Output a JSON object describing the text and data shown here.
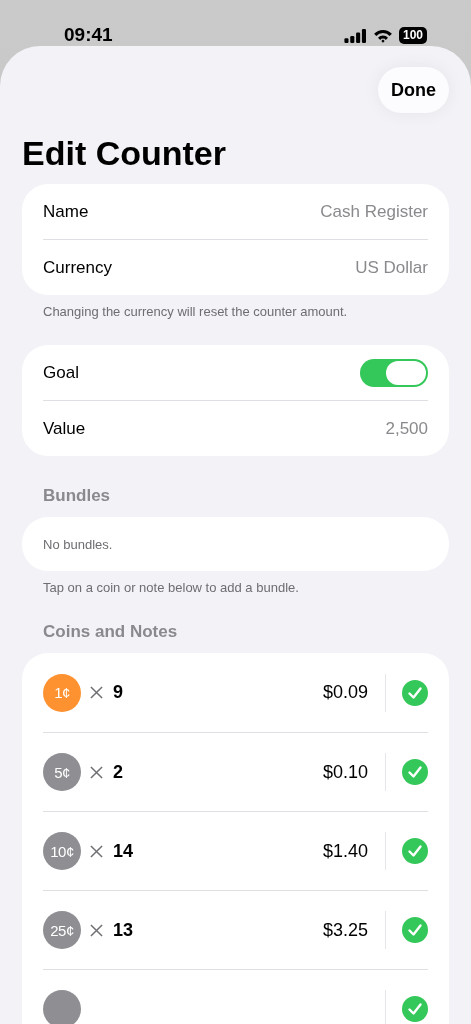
{
  "status_bar": {
    "time": "09:41",
    "battery": "100"
  },
  "done_button": "Done",
  "title": "Edit Counter",
  "details": {
    "rows": [
      {
        "label": "Name",
        "value": "Cash Register"
      },
      {
        "label": "Currency",
        "value": "US Dollar"
      }
    ],
    "footer": "Changing the currency will reset the counter amount."
  },
  "goal": {
    "rows": [
      {
        "kind": "toggle",
        "label": "Goal",
        "on": true
      },
      {
        "kind": "value",
        "label": "Value",
        "value": "2,500"
      }
    ]
  },
  "bundles": {
    "header": "Bundles",
    "empty": "No bundles.",
    "footer": "Tap on a coin or note below to add a bundle."
  },
  "coins": {
    "header": "Coins and Notes",
    "items": [
      {
        "coin": "1¢",
        "color": "#ff9230",
        "count": "9",
        "amount": "$0.09",
        "checked": true
      },
      {
        "coin": "5¢",
        "color": "#8e8e93",
        "count": "2",
        "amount": "$0.10",
        "checked": true
      },
      {
        "coin": "10¢",
        "color": "#8e8e93",
        "count": "14",
        "amount": "$1.40",
        "checked": true
      },
      {
        "coin": "25¢",
        "color": "#8e8e93",
        "count": "13",
        "amount": "$3.25",
        "checked": true
      },
      {
        "color": "#8e8e93",
        "checked": true
      }
    ]
  }
}
